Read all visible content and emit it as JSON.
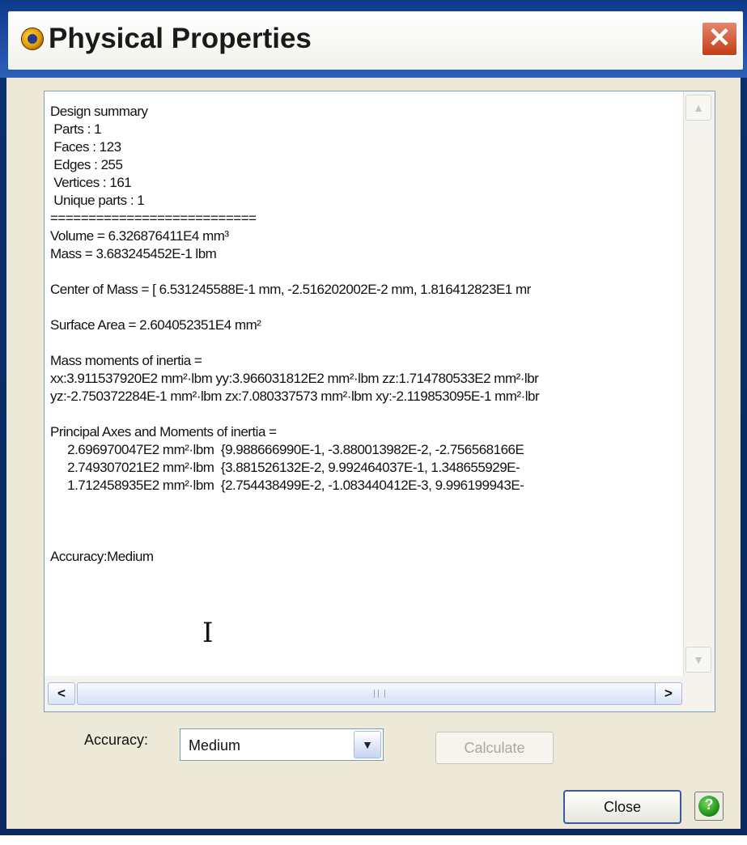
{
  "window": {
    "title": "Physical Properties",
    "close_glyph": "✕"
  },
  "report_lines": [
    "Design summary",
    " Parts : 1",
    " Faces : 123",
    " Edges : 255",
    " Vertices : 161",
    " Unique parts : 1",
    "===========================",
    "Volume = 6.326876411E4 mm³",
    "Mass = 3.683245452E-1 lbm",
    "",
    "Center of Mass = [ 6.531245588E-1 mm, -2.516202002E-2 mm, 1.816412823E1 mr",
    "",
    "Surface Area = 2.604052351E4 mm²",
    "",
    "Mass moments of inertia =",
    "xx:3.911537920E2 mm²·lbm yy:3.966031812E2 mm²·lbm zz:1.714780533E2 mm²·lbr",
    "yz:-2.750372284E-1 mm²·lbm zx:7.080337573 mm²·lbm xy:-2.119853095E-1 mm²·lbr",
    "",
    "Principal Axes and Moments of inertia =",
    "     2.696970047E2 mm²·lbm  {9.988666990E-1, -3.880013982E-2, -2.756568166E",
    "     2.749307021E2 mm²·lbm  {3.881526132E-2, 9.992464037E-1, 1.348655929E-",
    "     1.712458935E2 mm²·lbm  {2.754438499E-2, -1.083440412E-3, 9.996199943E-",
    "",
    "",
    "",
    "Accuracy:Medium"
  ],
  "scrollbar": {
    "up": "▲",
    "down": "▼",
    "left": "<",
    "right": ">"
  },
  "controls": {
    "accuracy_label": "Accuracy:",
    "accuracy_value": "Medium",
    "calculate_label": "Calculate",
    "close_label": "Close",
    "help_glyph": "?"
  },
  "icons": [
    "app-logo-icon",
    "close-icon",
    "text-cursor-icon",
    "chevron-down-icon",
    "help-icon"
  ]
}
